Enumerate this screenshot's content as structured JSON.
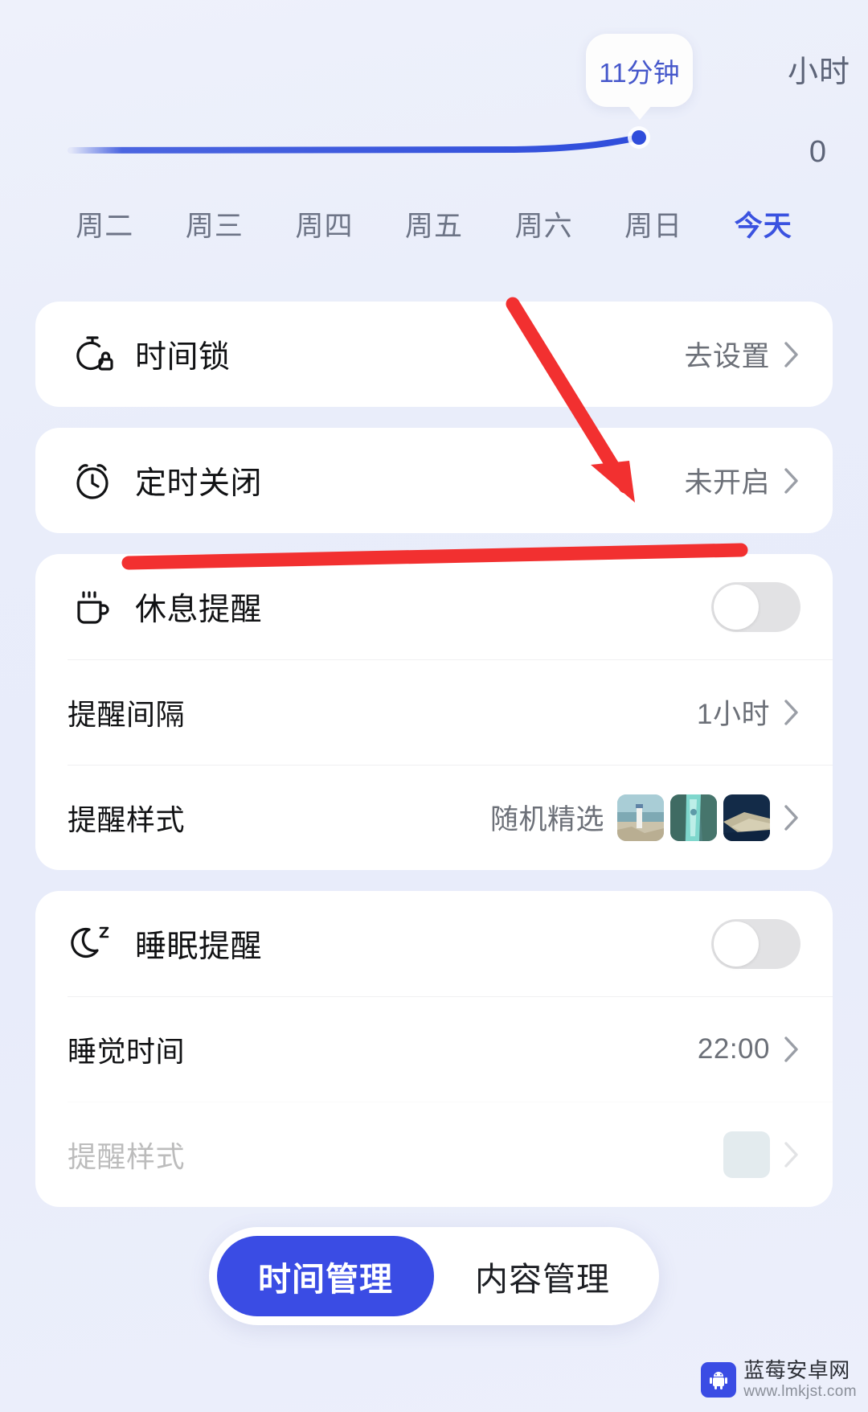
{
  "chart_data": {
    "type": "line",
    "title": "",
    "xlabel": "",
    "ylabel": "小时",
    "categories": [
      "周二",
      "周三",
      "周四",
      "周五",
      "周六",
      "周日",
      "今天"
    ],
    "values": [
      0,
      0,
      0,
      0,
      0,
      0,
      0.183
    ],
    "ylim": [
      0,
      1
    ],
    "yticks": [
      "小时",
      "0"
    ],
    "grid": false,
    "legend": "none",
    "highlight_index": 6,
    "highlight_label": "11分钟",
    "line_color": "#2f4ddb",
    "point_color": "#2f4ddb"
  },
  "chart": {
    "tooltip_value": "11分钟",
    "axis_unit_label": "小时",
    "axis_zero_label": "0"
  },
  "days": {
    "items": [
      {
        "label": "周二",
        "active": false
      },
      {
        "label": "周三",
        "active": false
      },
      {
        "label": "周四",
        "active": false
      },
      {
        "label": "周五",
        "active": false
      },
      {
        "label": "周六",
        "active": false
      },
      {
        "label": "周日",
        "active": false
      },
      {
        "label": "今天",
        "active": true
      }
    ]
  },
  "cards": {
    "time_lock": {
      "label": "时间锁",
      "value": "去设置"
    },
    "scheduled_off": {
      "label": "定时关闭",
      "value": "未开启"
    },
    "break_reminder": {
      "label": "休息提醒",
      "toggle_state": "off",
      "interval_label": "提醒间隔",
      "interval_value": "1小时",
      "style_label": "提醒样式",
      "style_value": "随机精选",
      "thumbnails": [
        "lighthouse-thumbnail",
        "waterfall-thumbnail",
        "coastline-thumbnail"
      ]
    },
    "sleep_reminder": {
      "label": "睡眠提醒",
      "toggle_state": "off",
      "bedtime_label": "睡觉时间",
      "bedtime_value": "22:00",
      "partial_label": "提醒样式"
    }
  },
  "tabbar": {
    "tabs": [
      {
        "label": "时间管理",
        "active": true
      },
      {
        "label": "内容管理",
        "active": false
      }
    ],
    "active_color": "#3a4ce4"
  },
  "annotation": {
    "color": "#f23030",
    "arrow": "down-right-arrow",
    "underline": "horizontal-underline"
  },
  "watermark": {
    "title": "蓝莓安卓网",
    "url": "www.lmkjst.com"
  }
}
